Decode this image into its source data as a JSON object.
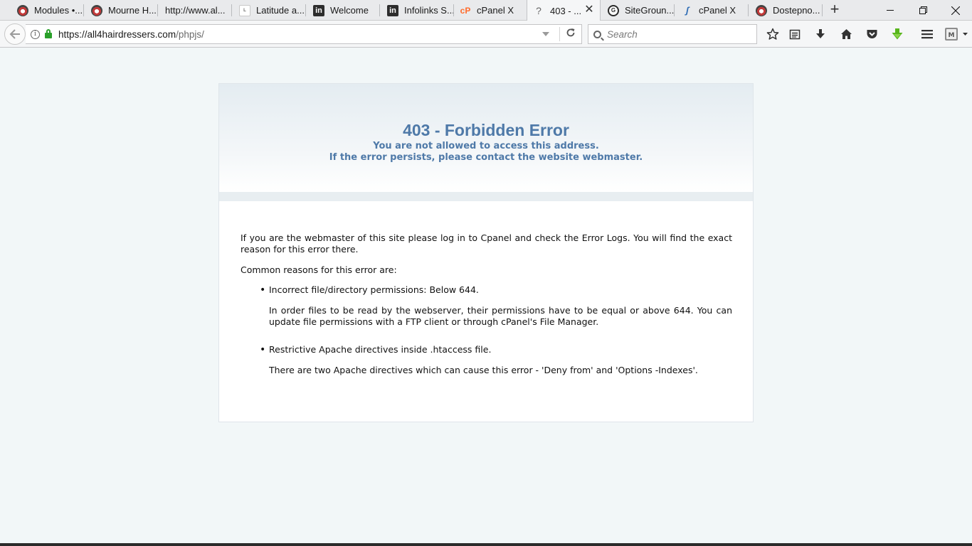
{
  "tabs": [
    {
      "label": "Modules •...",
      "icon": "joomla-icon",
      "active": false
    },
    {
      "label": "Mourne H...",
      "icon": "joomla-icon",
      "active": false
    },
    {
      "label": "http://www.al...",
      "icon": "page-icon",
      "active": false
    },
    {
      "label": "Latitude a...",
      "icon": "latitude-icon",
      "active": false
    },
    {
      "label": "Welcome",
      "icon": "invision-icon",
      "active": false
    },
    {
      "label": "Infolinks S...",
      "icon": "invision-icon",
      "active": false
    },
    {
      "label": "cPanel X",
      "icon": "cpanel-icon",
      "active": false
    },
    {
      "label": "403 - ...",
      "icon": "question-icon",
      "active": true
    },
    {
      "label": "SiteGroun...",
      "icon": "siteground-icon",
      "active": false
    },
    {
      "label": "cPanel X",
      "icon": "cpanel-alt-icon",
      "active": false
    },
    {
      "label": "Dostepno...",
      "icon": "joomla-icon",
      "active": false
    }
  ],
  "navbar": {
    "url_host": "https://all4hairdressers.com",
    "url_path": "/phpjs/",
    "search_placeholder": "Search"
  },
  "page": {
    "title": "403 - Forbidden Error",
    "subtitle_1": "You are not allowed to access this address.",
    "subtitle_2": "If the error persists, please contact the website webmaster.",
    "intro": "If you are the webmaster of this site please log in to Cpanel and check the Error Logs. You will find the exact reason for this error there.",
    "reasons_heading": "Common reasons for this error are:",
    "reasons": [
      {
        "title": "Incorrect file/directory permissions: Below 644.",
        "detail": "In order files to be read by the webserver, their permissions have to be equal or above 644. You can update file permissions with a FTP client or through cPanel's File Manager."
      },
      {
        "title": "Restrictive Apache directives inside .htaccess file.",
        "detail": "There are two Apache directives which can cause this error - 'Deny from' and 'Options -Indexes'."
      }
    ]
  },
  "colors": {
    "error_blue": "#4e79a8",
    "page_bg": "#f2f7f8",
    "lock_green": "#2aa02a",
    "pocket_red": "#d7141a",
    "download_green": "#58b51c"
  }
}
